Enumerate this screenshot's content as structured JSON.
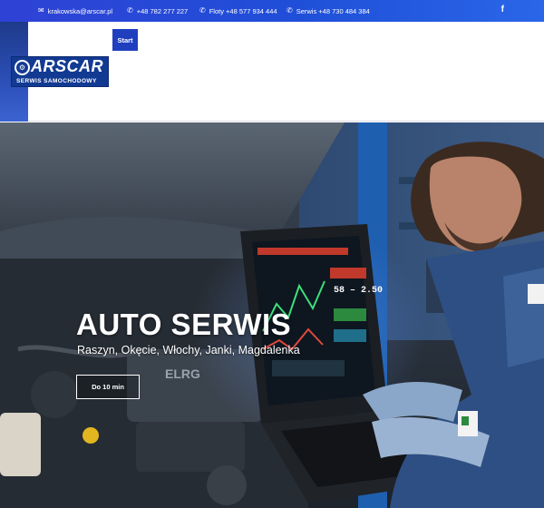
{
  "topbar": {
    "email": "krakowska@arscar.pl",
    "phone_main": "+48 782 277 227",
    "phone_fleet": "Floty +48 577 934 444",
    "phone_service": "Serwis +48 730 484 384",
    "social_icon": "facebook-icon",
    "social_glyph": "f",
    "icons": {
      "email": "envelope-icon",
      "phone": "phone-icon"
    }
  },
  "header": {
    "logo_text": "ARSCAR",
    "logo_sub": "SERWIS SAMOCHODOWY",
    "nav": [
      {
        "label": "Start"
      }
    ]
  },
  "hero": {
    "title": "AUTO SERWIS",
    "subtitle": "Raszyn, Okęcie, Włochy, Janki, Magdalenka",
    "cta": "Do 10 min",
    "laptop_readout": "58 – 2.50"
  },
  "colors": {
    "topbar": "#2f42d6",
    "brand": "#123a93",
    "nav_button": "#1f3fbf",
    "hero_text": "#ffffff"
  }
}
